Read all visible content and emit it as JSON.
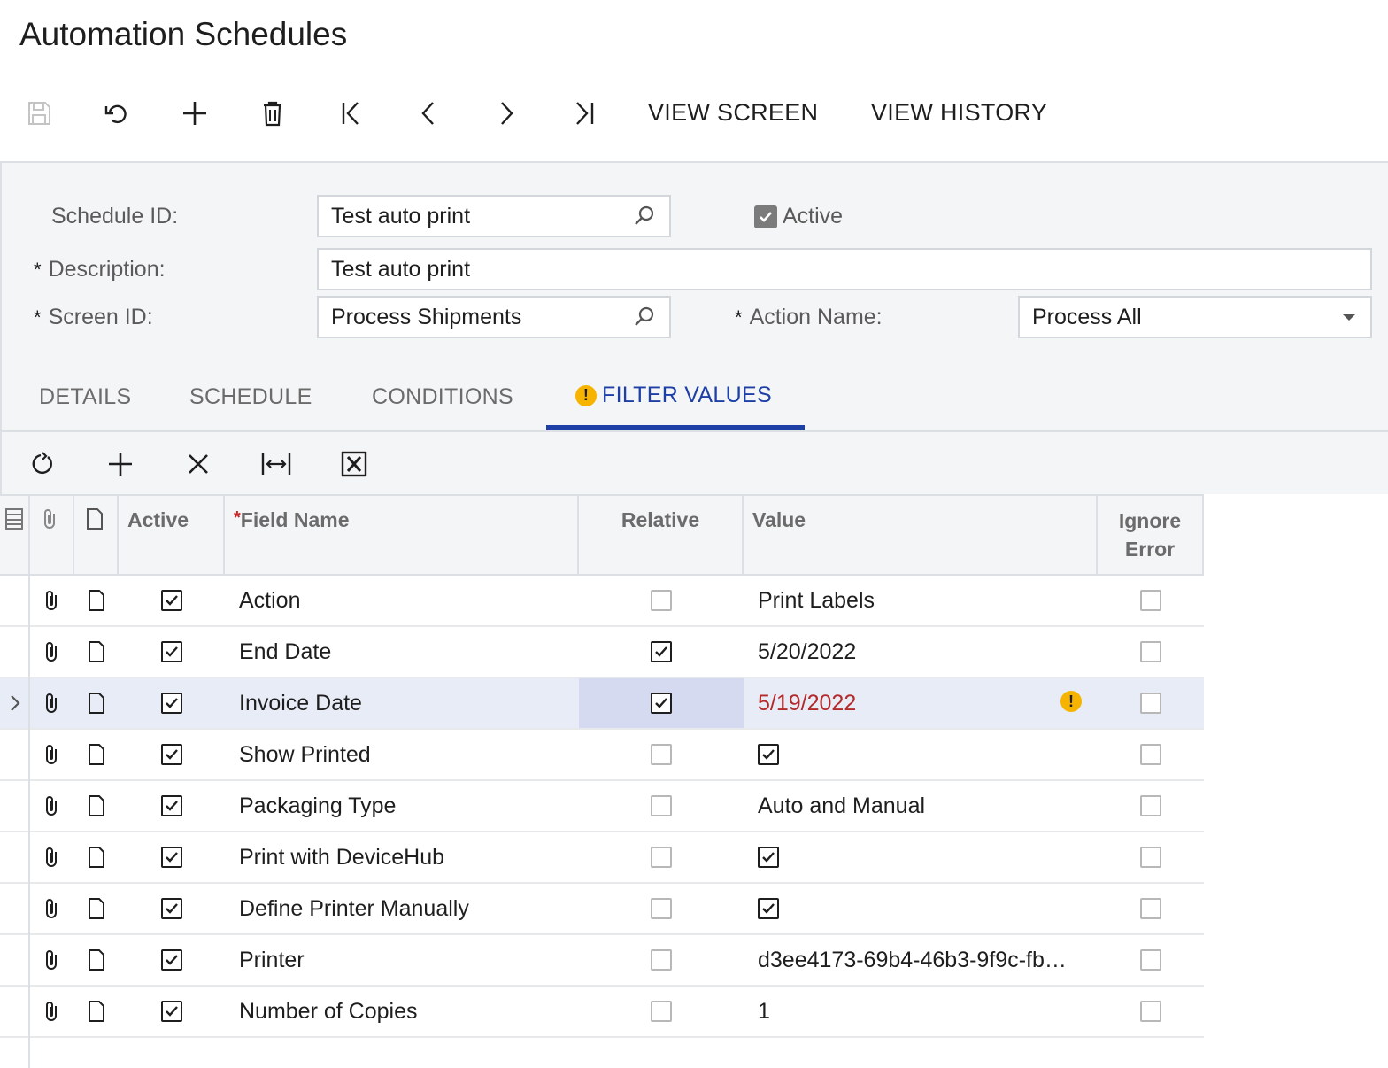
{
  "page": {
    "title": "Automation Schedules"
  },
  "toolbar": {
    "view_screen": "VIEW SCREEN",
    "view_history": "VIEW HISTORY"
  },
  "form": {
    "schedule_id_label": "Schedule ID:",
    "schedule_id_value": "Test auto print",
    "active_label": "Active",
    "active_checked": true,
    "description_label": "Description:",
    "description_value": "Test auto print",
    "screen_id_label": "Screen ID:",
    "screen_id_value": "Process Shipments",
    "action_name_label": "Action Name:",
    "action_name_value": "Process All",
    "required_marker": "*"
  },
  "tabs": [
    {
      "label": "DETAILS",
      "active": false
    },
    {
      "label": "SCHEDULE",
      "active": false
    },
    {
      "label": "CONDITIONS",
      "active": false
    },
    {
      "label": "FILTER VALUES",
      "active": true,
      "warning": true
    }
  ],
  "grid": {
    "headers": {
      "active": "Active",
      "field_name": "Field Name",
      "relative": "Relative",
      "value": "Value",
      "ignore_error_1": "Ignore",
      "ignore_error_2": "Error"
    },
    "rows": [
      {
        "active": true,
        "field_name": "Action",
        "relative": false,
        "value": "Print Labels",
        "value_type": "text",
        "ignore_error": false
      },
      {
        "active": true,
        "field_name": "End Date",
        "relative": true,
        "value": "5/20/2022",
        "value_type": "text",
        "ignore_error": false
      },
      {
        "active": true,
        "field_name": "Invoice Date",
        "relative": true,
        "value": "5/19/2022",
        "value_type": "text",
        "ignore_error": false,
        "selected": true,
        "error": true
      },
      {
        "active": true,
        "field_name": "Show Printed",
        "relative": false,
        "value": "",
        "value_type": "checkbox",
        "value_checked": true,
        "ignore_error": false
      },
      {
        "active": true,
        "field_name": "Packaging Type",
        "relative": false,
        "value": "Auto and Manual",
        "value_type": "text",
        "ignore_error": false
      },
      {
        "active": true,
        "field_name": "Print with DeviceHub",
        "relative": false,
        "value": "",
        "value_type": "checkbox",
        "value_checked": true,
        "ignore_error": false
      },
      {
        "active": true,
        "field_name": "Define Printer Manually",
        "relative": false,
        "value": "",
        "value_type": "checkbox",
        "value_checked": true,
        "ignore_error": false
      },
      {
        "active": true,
        "field_name": "Printer",
        "relative": false,
        "value": "d3ee4173-69b4-46b3-9f9c-fb…",
        "value_type": "text",
        "ignore_error": false
      },
      {
        "active": true,
        "field_name": "Number of Copies",
        "relative": false,
        "value": "1",
        "value_type": "text",
        "ignore_error": false
      }
    ]
  },
  "colors": {
    "accent": "#1e3fa6",
    "warning": "#f6b400",
    "error_text": "#b22a2a",
    "selected_row": "#e8ecf7",
    "selected_cell": "#d5daf0"
  }
}
